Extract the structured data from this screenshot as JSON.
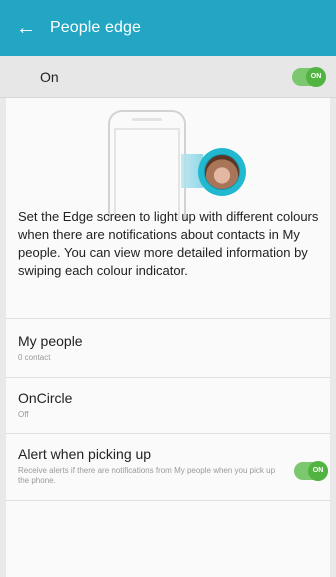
{
  "app_bar": {
    "title": "People edge",
    "back_icon": "arrow-left-icon"
  },
  "master_switch": {
    "label": "On",
    "state_text": "ON",
    "enabled": true,
    "color": "#51b341"
  },
  "description": "Set the Edge screen to light up with different colours when there are notifications about contacts in My people. You can view more detailed information by swiping each colour indicator.",
  "settings": {
    "my_people": {
      "title": "My people",
      "subtitle": "0 contact"
    },
    "oncircle": {
      "title": "OnCircle",
      "subtitle": "Off"
    },
    "alert": {
      "title": "Alert when picking up",
      "subtitle": "Receive alerts if there are notifications from My people when you pick up the phone.",
      "state_text": "ON",
      "enabled": true
    }
  },
  "colors": {
    "accent": "#22a6c4",
    "switch_on": "#51b341"
  }
}
